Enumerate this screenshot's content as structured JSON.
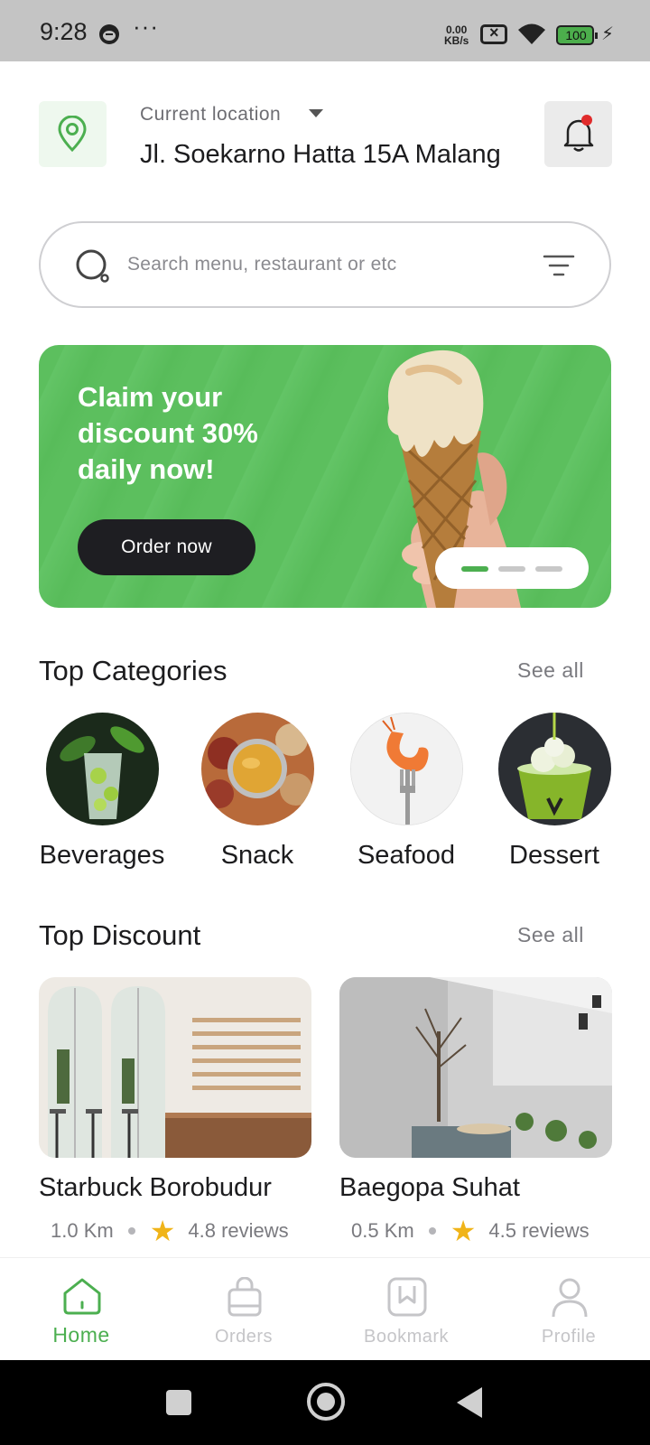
{
  "status_bar": {
    "time": "9:28",
    "dots": "···",
    "speed_value": "0.00",
    "speed_unit": "KB/s",
    "battery": "100"
  },
  "header": {
    "location_label": "Current location",
    "location_value": "Jl. Soekarno Hatta 15A Malang",
    "location_icon": "map-pin-icon",
    "notification_icon": "bell-icon",
    "has_unread_notification": true
  },
  "search": {
    "placeholder": "Search menu, restaurant or etc",
    "value": ""
  },
  "banner": {
    "title": "Claim your discount 30% daily now!",
    "button_label": "Order now",
    "page_count": 3,
    "active_page": 1,
    "colors": {
      "background": "#5cbf5e",
      "button": "#1e1e22"
    }
  },
  "categories": {
    "title": "Top Categories",
    "see_all": "See all",
    "items": [
      {
        "label": "Beverages"
      },
      {
        "label": "Snack"
      },
      {
        "label": "Seafood"
      },
      {
        "label": "Dessert"
      }
    ]
  },
  "discounts": {
    "title": "Top Discount",
    "see_all": "See all",
    "items": [
      {
        "name": "Starbuck Borobudur",
        "distance": "1.0 Km",
        "rating": "4.8 reviews"
      },
      {
        "name": "Baegopa Suhat",
        "distance": "0.5 Km",
        "rating": "4.5 reviews"
      }
    ]
  },
  "bottom_nav": {
    "items": [
      {
        "label": "Home",
        "icon": "home-icon",
        "active": true
      },
      {
        "label": "Orders",
        "icon": "shopping-bag-icon",
        "active": false
      },
      {
        "label": "Bookmark",
        "icon": "bookmark-icon",
        "active": false
      },
      {
        "label": "Profile",
        "icon": "profile-icon",
        "active": false
      }
    ]
  },
  "theme": {
    "accent": "#4caf50",
    "text": "#1c1c1e",
    "muted": "#7a7a7f",
    "star": "#f0b419"
  }
}
